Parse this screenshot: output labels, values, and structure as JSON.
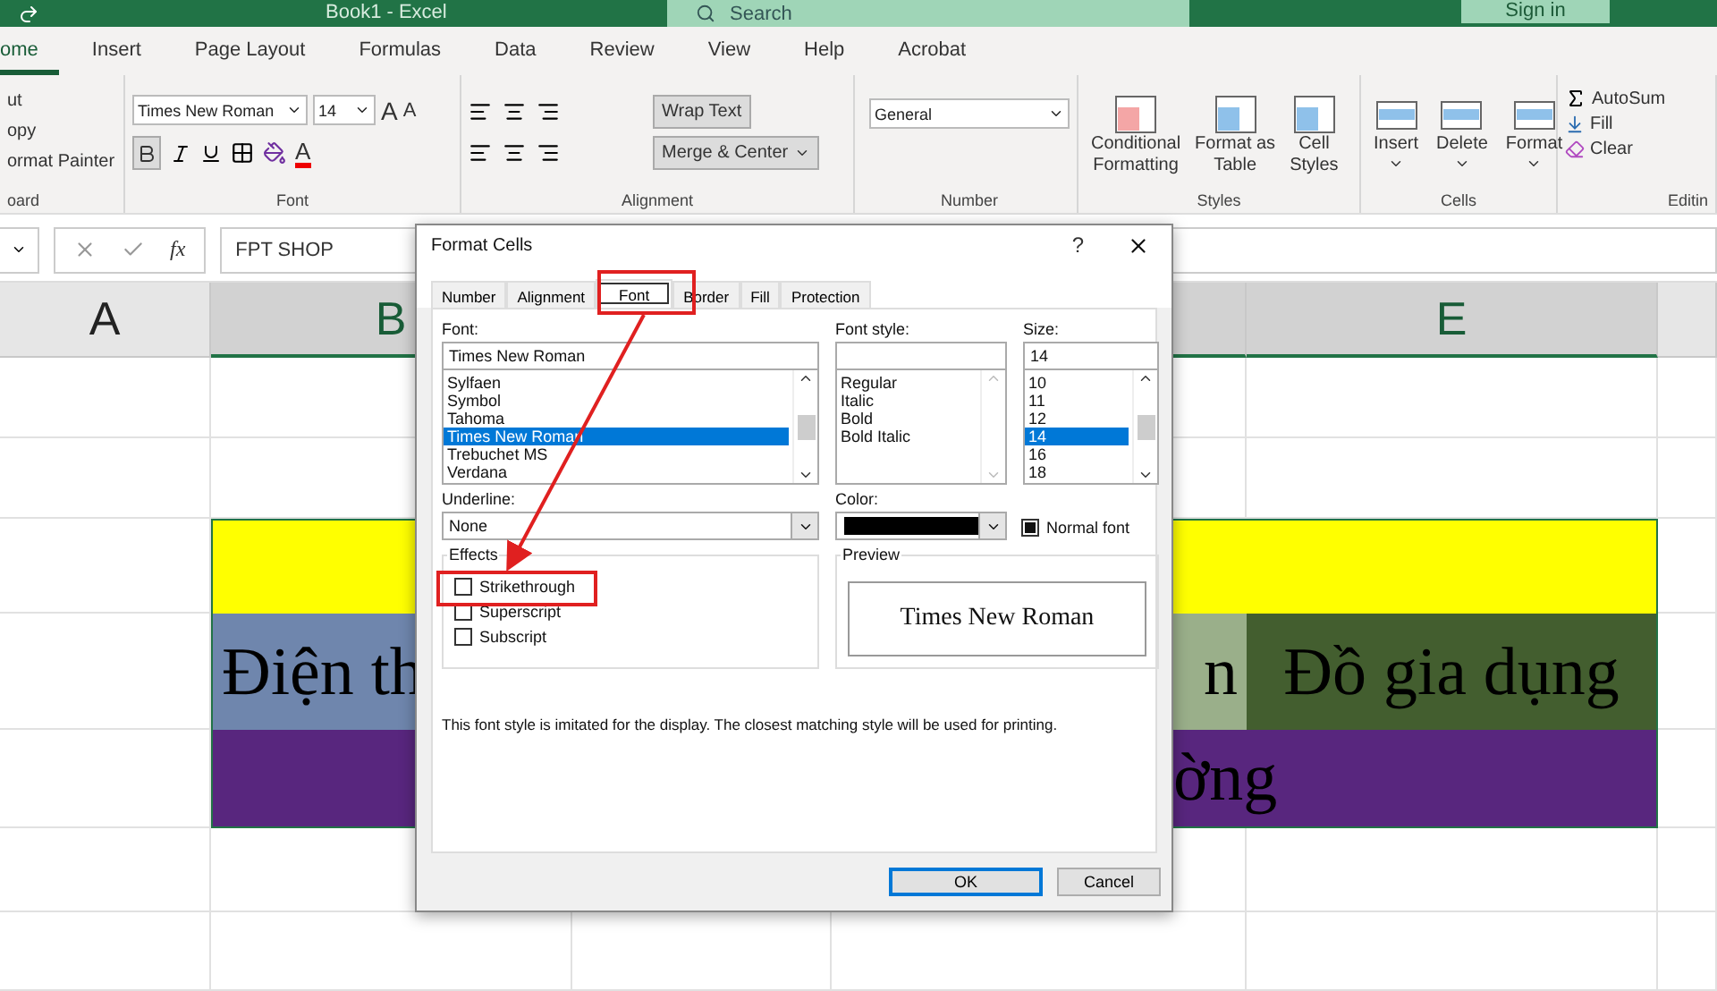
{
  "window": {
    "title": "Book1  -  Excel"
  },
  "search": {
    "placeholder": "Search"
  },
  "account": {
    "label": "Sign in"
  },
  "ribbon_tabs": [
    {
      "label": "ome",
      "selected": true
    },
    {
      "label": "Insert",
      "selected": false
    },
    {
      "label": "Page Layout",
      "selected": false
    },
    {
      "label": "Formulas",
      "selected": false
    },
    {
      "label": "Data",
      "selected": false
    },
    {
      "label": "Review",
      "selected": false
    },
    {
      "label": "View",
      "selected": false
    },
    {
      "label": "Help",
      "selected": false
    },
    {
      "label": "Acrobat",
      "selected": false
    }
  ],
  "ribbon": {
    "clipboard": {
      "items": [
        "ut",
        "opy",
        "ormat Painter"
      ],
      "label": "oard"
    },
    "font": {
      "name": "Times New Roman",
      "size": "14",
      "grow": "A",
      "shrink": "A",
      "color_glyph": "A",
      "bold": true,
      "label": "Font"
    },
    "alignment": {
      "wrap_text": "Wrap Text",
      "merge": "Merge & Center",
      "label": "Alignment"
    },
    "number": {
      "format": "General",
      "label": "Number"
    },
    "styles": {
      "items": [
        {
          "line1": "Conditional",
          "line2": "Formatting"
        },
        {
          "line1": "Format as",
          "line2": "Table"
        },
        {
          "line1": "Cell",
          "line2": "Styles"
        }
      ],
      "label": "Styles"
    },
    "cells": {
      "items": [
        "Insert",
        "Delete",
        "Format"
      ],
      "label": "Cells"
    },
    "editing": {
      "items": [
        "AutoSum",
        "Fill",
        "Clear"
      ],
      "label": "Editin"
    }
  },
  "formula_bar": {
    "function_label": "fx",
    "value": "FPT SHOP"
  },
  "sheet": {
    "columns": [
      {
        "label": "A",
        "selected": false
      },
      {
        "label": "B",
        "selected": true
      },
      {
        "selected": true
      },
      {
        "label": "E",
        "selected": true
      }
    ],
    "bands": [
      {
        "kind": "merged",
        "color": "#ffff00"
      },
      {
        "kind": "cells",
        "cells": [
          {
            "text": "Điện th",
            "color": "#6f86ad"
          },
          {
            "text": "n",
            "color": "#9aaf8a"
          },
          {
            "text": "Đồ gia dụng",
            "color": "#435e2f"
          }
        ]
      },
      {
        "kind": "merged",
        "color": "#58267e",
        "text": "ờng"
      }
    ]
  },
  "dialog": {
    "title": "Format Cells",
    "help": "?",
    "tabs": [
      {
        "label": "Number",
        "selected": false
      },
      {
        "label": "Alignment",
        "selected": false
      },
      {
        "label": "Font",
        "selected": true
      },
      {
        "label": "Border",
        "selected": false
      },
      {
        "label": "Fill",
        "selected": false
      },
      {
        "label": "Protection",
        "selected": false
      }
    ],
    "font": {
      "label": "Font:",
      "value": "Times New Roman",
      "options": [
        {
          "label": "Sylfaen",
          "selected": false
        },
        {
          "label": "Symbol",
          "selected": false
        },
        {
          "label": "Tahoma",
          "selected": false
        },
        {
          "label": "Times New Roman",
          "selected": true
        },
        {
          "label": "Trebuchet MS",
          "selected": false
        },
        {
          "label": "Verdana",
          "selected": false
        }
      ]
    },
    "font_style": {
      "label": "Font style:",
      "options": [
        {
          "label": "Regular",
          "selected": false
        },
        {
          "label": "Italic",
          "selected": false
        },
        {
          "label": "Bold",
          "selected": false
        },
        {
          "label": "Bold Italic",
          "selected": false
        }
      ]
    },
    "size": {
      "label": "Size:",
      "value": "14",
      "options": [
        {
          "label": "10",
          "selected": false
        },
        {
          "label": "11",
          "selected": false
        },
        {
          "label": "12",
          "selected": false
        },
        {
          "label": "14",
          "selected": true
        },
        {
          "label": "16",
          "selected": false
        },
        {
          "label": "18",
          "selected": false
        }
      ]
    },
    "underline": {
      "label": "Underline:",
      "value": "None"
    },
    "color": {
      "label": "Color:",
      "color": "#000000"
    },
    "normal_font": {
      "label": "Normal font",
      "checked": true
    },
    "effects": {
      "label": "Effects",
      "items": [
        {
          "label": "Strikethrough",
          "checked": false
        },
        {
          "label": "Superscript",
          "checked": false
        },
        {
          "label": "Subscript",
          "checked": false
        }
      ]
    },
    "preview": {
      "label": "Preview",
      "text": "Times New Roman"
    },
    "note": "This font style is imitated for the display.  The closest matching style will be used for printing.",
    "buttons": [
      {
        "label": "OK",
        "default": true
      },
      {
        "label": "Cancel",
        "default": false
      }
    ]
  }
}
